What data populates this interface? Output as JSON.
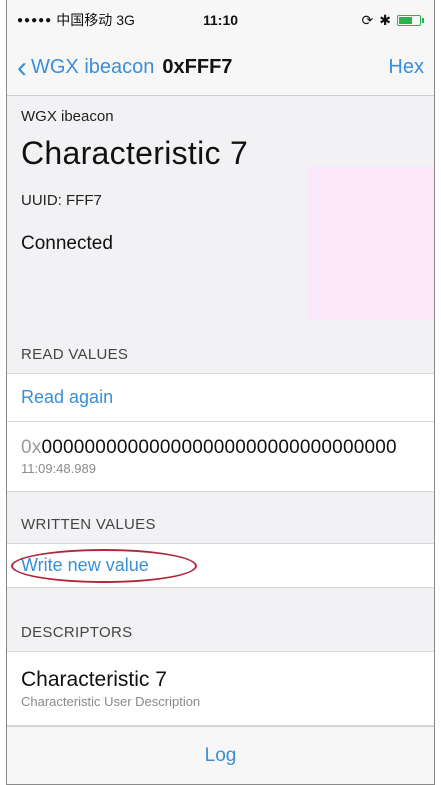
{
  "status_bar": {
    "dots": "●●●●●",
    "carrier": "中国移动",
    "network": "3G",
    "time": "11:10",
    "rotation_icon": "rotation-lock-icon",
    "bluetooth_icon": "bluetooth-icon",
    "battery_icon": "battery-icon"
  },
  "nav": {
    "back_label": "WGX ibeacon",
    "title": "0xFFF7",
    "right_label": "Hex"
  },
  "header": {
    "device_name": "WGX ibeacon",
    "title": "Characteristic 7",
    "uuid": "UUID: FFF7",
    "status": "Connected"
  },
  "sections": {
    "read_values": "READ VALUES",
    "written_values": "WRITTEN VALUES",
    "descriptors": "DESCRIPTORS"
  },
  "read": {
    "action": "Read again",
    "value_prefix": "0x",
    "value": "000000000000000000000000000000000",
    "timestamp": "11:09:48.989"
  },
  "write": {
    "action": "Write new value"
  },
  "descriptor": {
    "title": "Characteristic 7",
    "subtitle": "Characteristic User Description"
  },
  "bottom": {
    "log_label": "Log"
  },
  "colors": {
    "accent": "#3a8fd6",
    "annotation": "#b0283a"
  }
}
